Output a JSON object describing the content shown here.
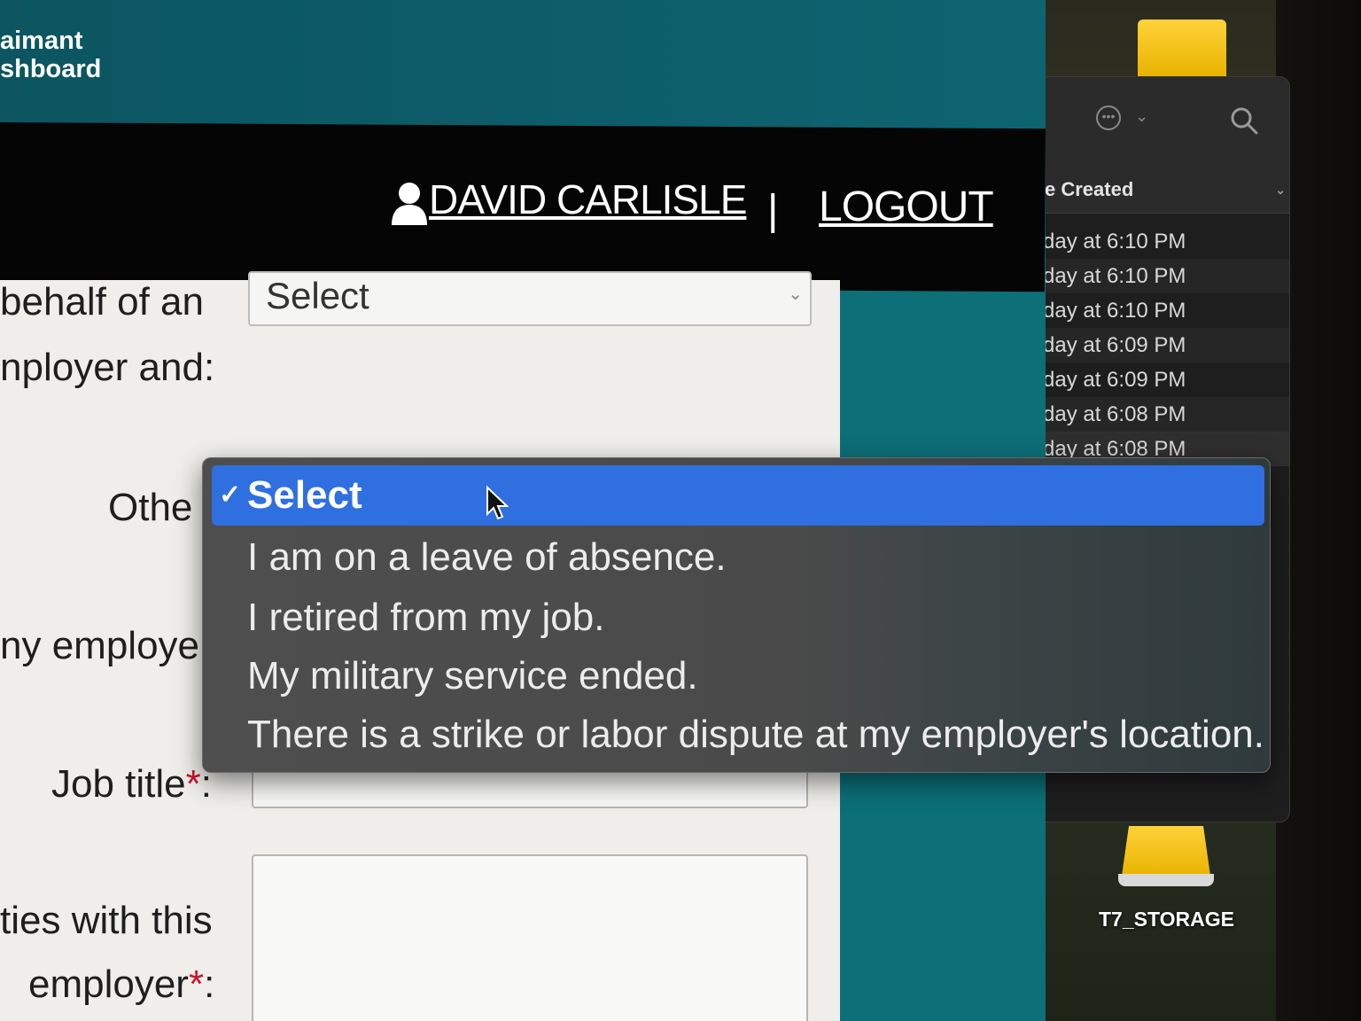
{
  "app": {
    "brand_line1": "aimant",
    "brand_line2": "shboard"
  },
  "nav": {
    "user_name": "DAVID CARLISLE",
    "separator": "|",
    "logout": "LOGOUT"
  },
  "form": {
    "label_behalf": "behalf of an",
    "label_employer_and": "nployer and:",
    "select_value": "Select",
    "label_other": "Othe",
    "label_my_employer": "ny employe",
    "label_job_title": "Job title",
    "label_job_title_colon": ":",
    "label_duties": "ties with this",
    "label_employer": "employer",
    "label_employer_colon": ":",
    "required_mark": "*"
  },
  "dropdown": {
    "selected_check": "✓",
    "options": [
      "Select",
      "I am on a leave of absence.",
      "I retired from my job.",
      "My military service ended.",
      "There is a strike or labor dispute at my employer's location."
    ]
  },
  "finder": {
    "column_header": "e Created",
    "rows": [
      "day at 6:10 PM",
      "day at 6:10 PM",
      "day at 6:10 PM",
      "day at 6:09 PM",
      "day at 6:09 PM",
      "day at 6:08 PM",
      "day at 6:08 PM"
    ]
  },
  "desktop": {
    "drive_label": "T7_STORAGE"
  },
  "colors": {
    "page_teal": "#0d6f78",
    "nav_black": "#050505",
    "selection_blue": "#2f6fe0",
    "required_red": "#d0102a"
  }
}
